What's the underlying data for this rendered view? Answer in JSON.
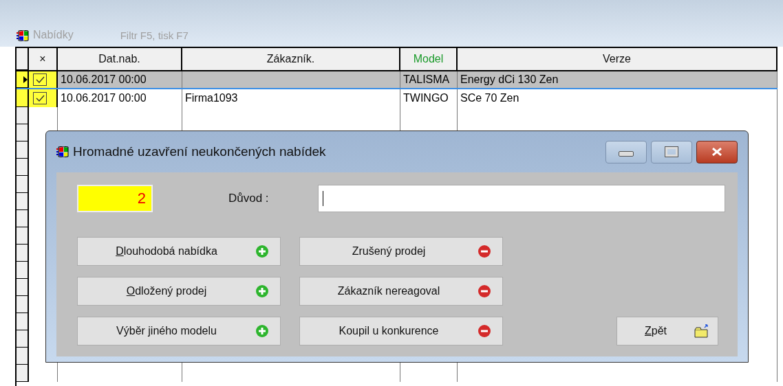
{
  "window": {
    "title": "Nabídky",
    "hint": "Filtr F5,  tisk F7"
  },
  "table": {
    "check_header": "×",
    "columns": [
      {
        "label": "Dat.nab.",
        "highlighted": false
      },
      {
        "label": "Zákazník.",
        "highlighted": false
      },
      {
        "label": "Model",
        "highlighted": true
      },
      {
        "label": "Verze",
        "highlighted": false
      }
    ],
    "rows": [
      {
        "selected": true,
        "checked": true,
        "cells": [
          "10.06.2017 00:00",
          "",
          "TALISMA",
          "Energy dCi 130 Zen"
        ]
      },
      {
        "selected": false,
        "checked": true,
        "cells": [
          "10.06.2017 00:00",
          "Firma1093",
          "TWINGO",
          "SCe 70 Zen"
        ]
      }
    ]
  },
  "dialog": {
    "title": "Hromadné uzavření neukončených nabídek",
    "count": "2",
    "reason_label": "Důvod  :",
    "buttons": [
      {
        "label": "Dlouhodobá nabídka",
        "kind": "plus",
        "underline_first": true
      },
      {
        "label": "Zrušený prodej",
        "kind": "minus",
        "underline_first": false
      },
      {
        "label": "Odložený prodej",
        "kind": "plus",
        "underline_first": true
      },
      {
        "label": "Zákazník nereagoval",
        "kind": "minus",
        "underline_first": false
      },
      {
        "label": "Výběr jiného modelu",
        "kind": "plus",
        "underline_first": false
      },
      {
        "label": "Koupil u konkurence",
        "kind": "minus",
        "underline_first": false
      }
    ],
    "back_button": {
      "label": "Zpět",
      "underline_first": true
    }
  }
}
